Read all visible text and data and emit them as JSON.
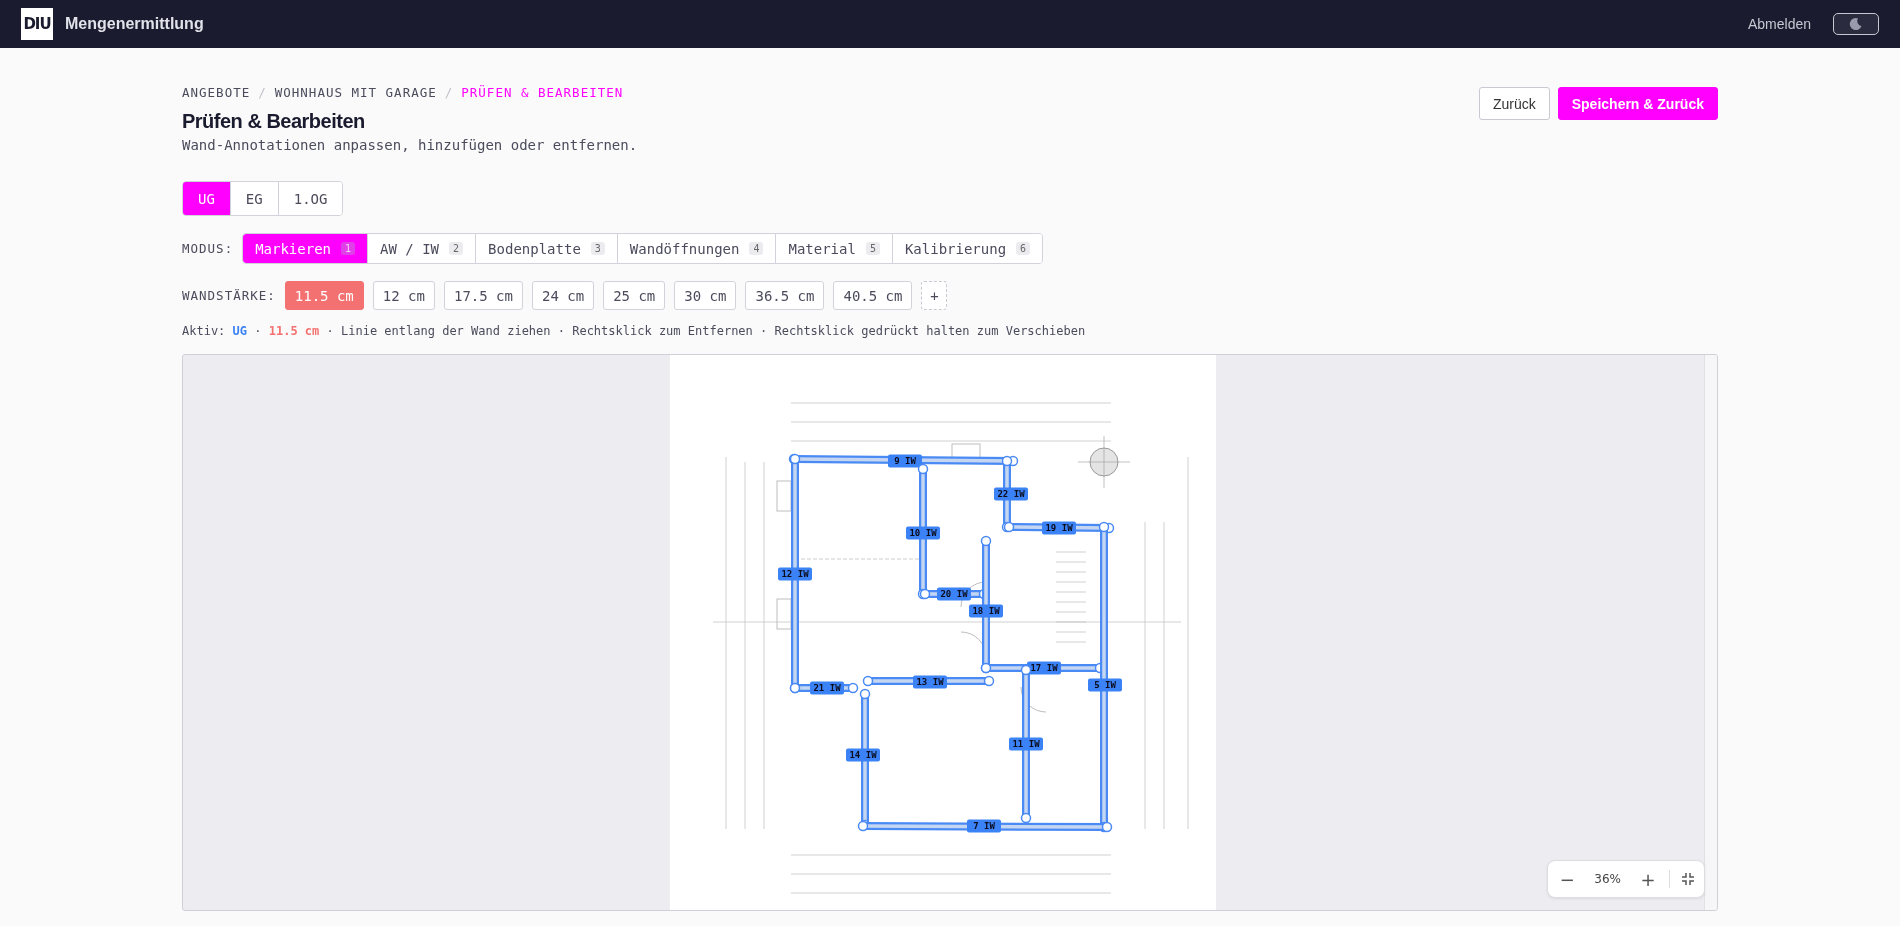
{
  "header": {
    "logo_text": "DIU",
    "title": "Mengenermittlung",
    "logout": "Abmelden",
    "dark_mode": false
  },
  "breadcrumbs": [
    {
      "label": "ANGEBOTE",
      "current": false
    },
    {
      "label": "WOHNHAUS MIT GARAGE",
      "current": false
    },
    {
      "label": "PRÜFEN & BEARBEITEN",
      "current": true
    }
  ],
  "breadcrumb_separator": "/",
  "title": "Prüfen & Bearbeiten",
  "subtitle": "Wand-Annotationen anpassen, hinzufügen oder entfernen.",
  "actions": [
    {
      "label": "Zurück",
      "kind": "secondary"
    },
    {
      "label": "Speichern & Zurück",
      "kind": "primary"
    }
  ],
  "floors": [
    {
      "label": "UG",
      "selected": true
    },
    {
      "label": "EG",
      "selected": false
    },
    {
      "label": "1.OG",
      "selected": false
    }
  ],
  "mode": {
    "label": "MODUS:",
    "items": [
      {
        "label": "Markieren",
        "key": "1",
        "selected": true
      },
      {
        "label": "AW / IW",
        "key": "2",
        "selected": false
      },
      {
        "label": "Bodenplatte",
        "key": "3",
        "selected": false
      },
      {
        "label": "Wandöffnungen",
        "key": "4",
        "selected": false
      },
      {
        "label": "Material",
        "key": "5",
        "selected": false
      },
      {
        "label": "Kalibrierung",
        "key": "6",
        "selected": false
      }
    ]
  },
  "thickness": {
    "label": "WANDSTÄRKE:",
    "add_label": "+",
    "items": [
      {
        "label": "11.5 cm",
        "selected": true
      },
      {
        "label": "12 cm",
        "selected": false
      },
      {
        "label": "17.5 cm",
        "selected": false
      },
      {
        "label": "24 cm",
        "selected": false
      },
      {
        "label": "25 cm",
        "selected": false
      },
      {
        "label": "30 cm",
        "selected": false
      },
      {
        "label": "36.5 cm",
        "selected": false
      },
      {
        "label": "40.5 cm",
        "selected": false
      }
    ]
  },
  "status": {
    "label": "Aktiv:",
    "floor": "UG",
    "thickness": "11.5 cm",
    "separator": "·",
    "hints": [
      "Linie entlang der Wand ziehen",
      "Rechtsklick zum Entfernen",
      "Rechtsklick gedrückt halten zum Verschieben"
    ]
  },
  "walls": [
    {
      "label": "9 IW"
    },
    {
      "label": "10 IW"
    },
    {
      "label": "12 IW"
    },
    {
      "label": "22 IW"
    },
    {
      "label": "19 IW"
    },
    {
      "label": "20 IW"
    },
    {
      "label": "18 IW"
    },
    {
      "label": "17 IW"
    },
    {
      "label": "13 IW"
    },
    {
      "label": "21 IW"
    },
    {
      "label": "5 IW"
    },
    {
      "label": "14 IW"
    },
    {
      "label": "11 IW"
    },
    {
      "label": "7 IW"
    }
  ],
  "zoom": {
    "minus": "−",
    "value": "36%",
    "plus": "+"
  }
}
